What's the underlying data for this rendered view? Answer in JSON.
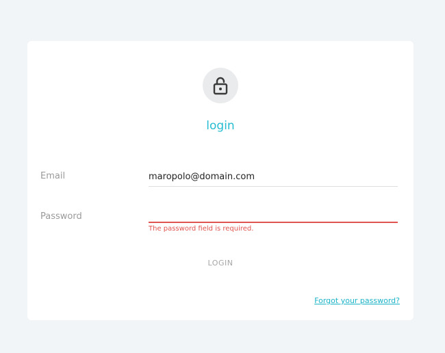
{
  "card": {
    "title": "login",
    "icon": "lock-icon"
  },
  "form": {
    "email": {
      "label": "Email",
      "value": "maropolo@domain.com"
    },
    "password": {
      "label": "Password",
      "value": "",
      "error": "The password field is required."
    },
    "login_label": "LOGIN",
    "forgot_label": "Forgot your password?"
  },
  "colors": {
    "accent": "#26bcd0",
    "error": "#e0534f",
    "background": "#f2f5f8"
  }
}
